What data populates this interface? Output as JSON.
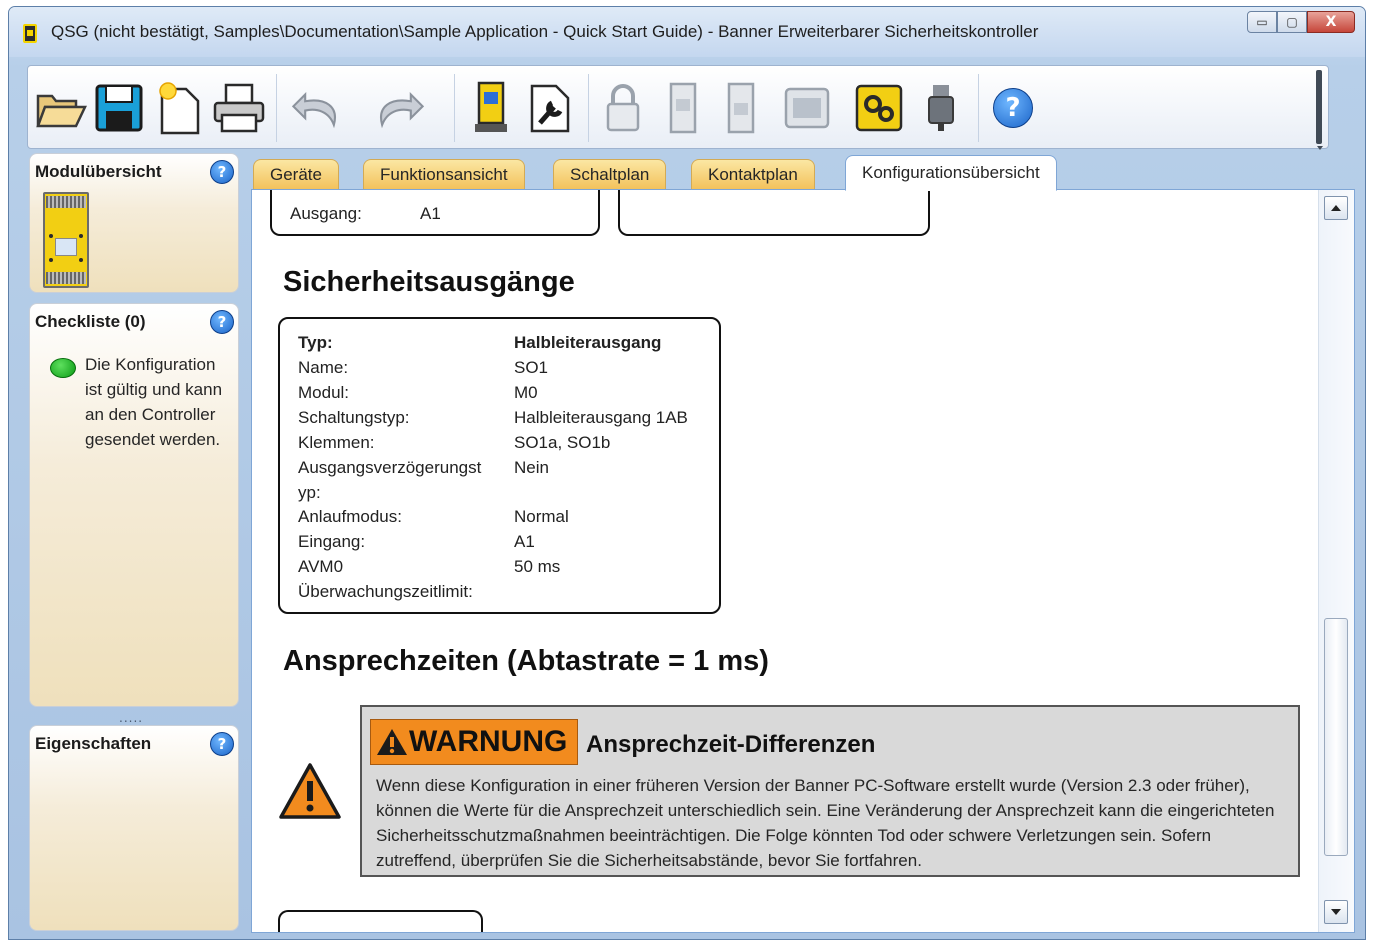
{
  "window": {
    "title": "QSG (nicht bestätigt, Samples\\Documentation\\Sample Application - Quick Start Guide) - Banner Erweiterbarer Sicherheitskontroller",
    "minimize_glyph": "▭",
    "maximize_glyph": "▢",
    "close_glyph": "X"
  },
  "toolbar": {
    "buttons": [
      {
        "name": "open-folder-icon",
        "enabled": true
      },
      {
        "name": "save-icon",
        "enabled": true
      },
      {
        "name": "new-document-icon",
        "enabled": true
      },
      {
        "name": "print-icon",
        "enabled": true
      },
      {
        "name": "undo-icon",
        "enabled": false
      },
      {
        "name": "redo-icon",
        "enabled": false
      },
      {
        "name": "device-icon",
        "enabled": true
      },
      {
        "name": "configure-icon",
        "enabled": true
      },
      {
        "name": "lock-icon",
        "enabled": false
      },
      {
        "name": "module-read-icon",
        "enabled": false
      },
      {
        "name": "module-write-icon",
        "enabled": false
      },
      {
        "name": "display-module-icon",
        "enabled": false
      },
      {
        "name": "simulation-gears-icon",
        "enabled": true
      },
      {
        "name": "usb-icon",
        "enabled": true
      },
      {
        "name": "help-icon",
        "enabled": true
      }
    ],
    "help_glyph": "?"
  },
  "left": {
    "module_overview": {
      "title": "Modulübersicht"
    },
    "checklist": {
      "title": "Checkliste (0)",
      "status_text": "Die Konfiguration ist gültig und kann an den Controller gesendet werden."
    },
    "splitter": ".....",
    "properties": {
      "title": "Eigenschaften"
    },
    "help_glyph": "?"
  },
  "tabs": [
    {
      "label": "Geräte",
      "active": false
    },
    {
      "label": "Funktionsansicht",
      "active": false
    },
    {
      "label": "Schaltplan",
      "active": false
    },
    {
      "label": "Kontaktplan",
      "active": false
    },
    {
      "label": "Konfigurationsübersicht",
      "active": true
    }
  ],
  "content": {
    "partial_box": {
      "key": "Ausgang:",
      "value": "A1"
    },
    "section1": "Sicherheitsausgänge",
    "output": {
      "rows": [
        {
          "key": "Typ:",
          "value": "Halbleiterausgang",
          "bold": true
        },
        {
          "key": "Name:",
          "value": "SO1"
        },
        {
          "key": "Modul:",
          "value": "M0"
        },
        {
          "key": "Schaltungstyp:",
          "value": "Halbleiterausgang 1AB"
        },
        {
          "key": "Klemmen:",
          "value": "SO1a, SO1b"
        },
        {
          "key": "Ausgangsverzögerungst",
          "value": "Nein"
        },
        {
          "key": "yp:",
          "value": ""
        },
        {
          "key": "Anlaufmodus:",
          "value": "Normal"
        },
        {
          "key": "Eingang:",
          "value": "A1"
        },
        {
          "key": "AVM0",
          "value": "50 ms"
        },
        {
          "key": "Überwachungszeitlimit:",
          "value": ""
        }
      ]
    },
    "section2": "Ansprechzeiten (Abtastrate = 1 ms)",
    "warning": {
      "badge": "WARNUNG",
      "title": "Ansprechzeit-Differenzen",
      "body": "Wenn diese Konfiguration in einer früheren Version der Banner PC-Software erstellt wurde (Version 2.3 oder früher), können die Werte für die Ansprechzeit unterschiedlich sein. Eine Veränderung der Ansprechzeit kann die eingerichteten Sicherheitsschutzmaßnahmen beeinträchtigen. Die Folge könnten Tod oder schwere Verletzungen sein. Sofern zutreffend, überprüfen Sie die Sicherheitsabstände, bevor Sie fortfahren."
    }
  },
  "colors": {
    "tab_gold": "#f3c25c",
    "warning_orange": "#f28b1e",
    "help_blue": "#1b64c8",
    "status_green": "#0a9a14"
  }
}
